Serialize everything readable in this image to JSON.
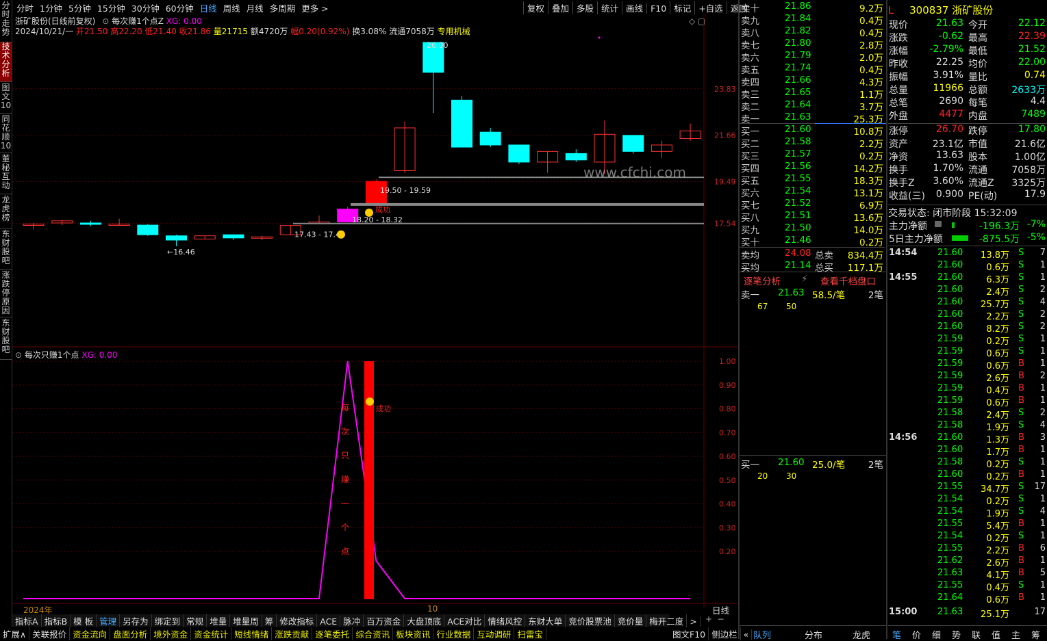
{
  "left_tabs": [
    "分时走势",
    "技术分析",
    "图文10",
    "同花顺10",
    "董秘互动",
    "龙虎榜",
    "东财股吧",
    "涨跌停原因",
    "东财股吧"
  ],
  "periods": [
    "分时",
    "1分钟",
    "5分钟",
    "15分钟",
    "30分钟",
    "60分钟",
    "日线",
    "周线",
    "月线",
    "多周期",
    "更多 >"
  ],
  "right_tools": [
    "复权",
    "叠加",
    "多股",
    "统计",
    "画线",
    "F10",
    "标记",
    "+自选",
    "返回"
  ],
  "chart": {
    "title": "浙矿股份(日线前复权)",
    "indicator_name": "每次赚1个点Z",
    "xg": "XG: 0.00",
    "info": {
      "date": "2024/10/21/一",
      "open": "开21.50",
      "high": "高22.20",
      "low": "低21.40",
      "close": "收21.86",
      "vol": "量21715",
      "amt": "额4720万",
      "chg": "幅0.20(0.92%)",
      "turn": "换3.08%",
      "float": "流通7058万",
      "sector": "专用机械"
    },
    "yticks": [
      "23.83",
      "21.66",
      "19.49",
      "17.54"
    ],
    "annotations": {
      "high": "26.00",
      "low": "←16.46",
      "r1": "19.50 - 19.59",
      "r2": "18.20 - 18.32",
      "r3": "17.43 - 17.43",
      "succ": "成功"
    },
    "watermark": "www.cfchi.com"
  },
  "sub": {
    "title": "每次只赚1个点",
    "xg": "XG: 0.00",
    "yticks": [
      "1.00",
      "0.90",
      "0.80",
      "0.70",
      "0.60",
      "0.50",
      "0.40",
      "0.30",
      "0.20"
    ],
    "vtext": [
      "每",
      "次",
      "只",
      "赚",
      "一",
      "个",
      "点"
    ],
    "succ": "成功"
  },
  "xaxis": {
    "year": "2024年",
    "mark": "10",
    "period": "日线"
  },
  "chart_data": {
    "type": "candlestick",
    "candles": [
      {
        "o": 17.45,
        "h": 17.55,
        "l": 17.25,
        "c": 17.5
      },
      {
        "o": 17.55,
        "h": 17.7,
        "l": 17.45,
        "c": 17.65
      },
      {
        "o": 17.55,
        "h": 17.65,
        "l": 17.4,
        "c": 17.5
      },
      {
        "o": 17.5,
        "h": 17.75,
        "l": 17.45,
        "c": 17.5
      },
      {
        "o": 17.45,
        "h": 17.5,
        "l": 16.95,
        "c": 17.0
      },
      {
        "o": 16.95,
        "h": 17.0,
        "l": 16.46,
        "c": 16.75
      },
      {
        "o": 16.8,
        "h": 16.95,
        "l": 16.8,
        "c": 16.95
      },
      {
        "o": 17.0,
        "h": 17.0,
        "l": 16.75,
        "c": 16.85
      },
      {
        "o": 16.85,
        "h": 16.95,
        "l": 16.75,
        "c": 16.9
      },
      {
        "o": 17.0,
        "h": 17.43,
        "l": 17.0,
        "c": 17.43
      },
      {
        "o": 17.55,
        "h": 17.9,
        "l": 17.55,
        "c": 17.6
      },
      {
        "o": 17.6,
        "h": 18.32,
        "l": 17.6,
        "c": 18.2
      },
      {
        "o": 18.4,
        "h": 19.59,
        "l": 18.3,
        "c": 19.5
      },
      {
        "o": 20.0,
        "h": 22.3,
        "l": 19.9,
        "c": 22.0
      },
      {
        "o": 26.0,
        "h": 26.0,
        "l": 22.7,
        "c": 24.6
      },
      {
        "o": 23.3,
        "h": 23.5,
        "l": 21.1,
        "c": 21.1
      },
      {
        "o": 21.8,
        "h": 22.0,
        "l": 21.1,
        "c": 21.2
      },
      {
        "o": 21.2,
        "h": 21.2,
        "l": 20.3,
        "c": 20.4
      },
      {
        "o": 20.4,
        "h": 20.9,
        "l": 19.9,
        "c": 20.9
      },
      {
        "o": 20.8,
        "h": 21.0,
        "l": 20.4,
        "c": 20.5
      },
      {
        "o": 20.4,
        "h": 22.35,
        "l": 19.85,
        "c": 21.7
      },
      {
        "o": 21.65,
        "h": 21.65,
        "l": 20.8,
        "c": 20.9
      },
      {
        "o": 20.9,
        "h": 21.4,
        "l": 20.6,
        "c": 21.2
      },
      {
        "o": 21.5,
        "h": 22.2,
        "l": 21.4,
        "c": 21.86
      }
    ],
    "sub_values": [
      0,
      0,
      0,
      0,
      0,
      0,
      0,
      0,
      0,
      0,
      0,
      1,
      0.05,
      0,
      0,
      0,
      0,
      0,
      0,
      0,
      0,
      0,
      0,
      0
    ]
  },
  "orderbook": {
    "asks": [
      [
        "卖十",
        "21.86",
        "9.2万"
      ],
      [
        "卖九",
        "21.84",
        "0.4万"
      ],
      [
        "卖八",
        "21.82",
        "0.4万"
      ],
      [
        "卖七",
        "21.80",
        "2.8万"
      ],
      [
        "卖六",
        "21.79",
        "2.0万"
      ],
      [
        "卖五",
        "21.74",
        "0.4万"
      ],
      [
        "卖四",
        "21.66",
        "4.3万"
      ],
      [
        "卖三",
        "21.65",
        "1.1万"
      ],
      [
        "卖二",
        "21.64",
        "3.7万"
      ],
      [
        "卖一",
        "21.63",
        "25.3万"
      ]
    ],
    "bids": [
      [
        "买一",
        "21.60",
        "10.8万"
      ],
      [
        "买二",
        "21.58",
        "2.2万"
      ],
      [
        "买三",
        "21.57",
        "0.2万"
      ],
      [
        "买四",
        "21.56",
        "14.2万"
      ],
      [
        "买五",
        "21.55",
        "18.3万"
      ],
      [
        "买六",
        "21.54",
        "13.1万"
      ],
      [
        "买七",
        "21.52",
        "6.9万"
      ],
      [
        "买八",
        "21.51",
        "13.6万"
      ],
      [
        "买九",
        "21.50",
        "14.0万"
      ],
      [
        "买十",
        "21.46",
        "0.2万"
      ]
    ],
    "avg_sell": [
      "卖均",
      "24.08",
      "总卖",
      "834.4万"
    ],
    "avg_buy": [
      "买均",
      "21.14",
      "总买",
      "117.1万"
    ],
    "tab1": "逐笔分析",
    "tab2": "查看千档盘口",
    "sell1": [
      "卖一",
      "21.63",
      "58.5/笔",
      "2笔"
    ],
    "sell1_q": [
      "67",
      "50"
    ],
    "buy1": [
      "买一",
      "21.60",
      "25.0/笔",
      "2笔"
    ],
    "buy1_q": [
      "20",
      "30"
    ]
  },
  "quote": {
    "flag": "L",
    "code": "300837",
    "name": "浙矿股份",
    "rows": [
      [
        "现价",
        "21.63",
        "今开",
        "22.12"
      ],
      [
        "涨跌",
        "-0.62",
        "最高",
        "22.39"
      ],
      [
        "涨幅",
        "-2.79%",
        "最低",
        "21.52"
      ],
      [
        "昨收",
        "22.25",
        "均价",
        "22.00"
      ],
      [
        "振幅",
        "3.91%",
        "量比",
        "0.74"
      ],
      [
        "总量",
        "11966",
        "总额",
        "2633万"
      ],
      [
        "总笔",
        "2690",
        "每笔",
        "4.4"
      ],
      [
        "外盘",
        "4477",
        "内盘",
        "7489"
      ]
    ],
    "rows2": [
      [
        "涨停",
        "26.70",
        "跌停",
        "17.80"
      ],
      [
        "资产",
        "23.1亿",
        "市值",
        "21.6亿"
      ],
      [
        "净资",
        "13.63",
        "股本",
        "1.00亿"
      ],
      [
        "换手",
        "1.70%",
        "流通",
        "7058万"
      ],
      [
        "换手Z",
        "3.60%",
        "流通Z",
        "3325万"
      ],
      [
        "收益(三)",
        "0.900",
        "PE(动)",
        "17.9"
      ]
    ],
    "status": "交易状态: 闭市阶段 15:32:09",
    "flow1": [
      "主力净额",
      "-196.3万",
      "-7%"
    ],
    "flow2": [
      "5日主力净额",
      "-875.5万",
      "-5%"
    ]
  },
  "trades": [
    [
      "14:54",
      "21.60",
      "13.8万",
      "S",
      "7"
    ],
    [
      "",
      "21.60",
      "0.6万",
      "S",
      "1"
    ],
    [
      "14:55",
      "21.60",
      "6.3万",
      "S",
      "1"
    ],
    [
      "",
      "21.60",
      "2.4万",
      "S",
      "2"
    ],
    [
      "",
      "21.60",
      "25.7万",
      "S",
      "4"
    ],
    [
      "",
      "21.60",
      "2.2万",
      "S",
      "2"
    ],
    [
      "",
      "21.60",
      "8.2万",
      "S",
      "2"
    ],
    [
      "",
      "21.59",
      "0.2万",
      "S",
      "1"
    ],
    [
      "",
      "21.59",
      "0.6万",
      "S",
      "1"
    ],
    [
      "",
      "21.59",
      "0.6万",
      "B",
      "1"
    ],
    [
      "",
      "21.59",
      "2.6万",
      "B",
      "2"
    ],
    [
      "",
      "21.59",
      "0.4万",
      "B",
      "1"
    ],
    [
      "",
      "21.59",
      "0.6万",
      "B",
      "1"
    ],
    [
      "",
      "21.58",
      "2.4万",
      "S",
      "2"
    ],
    [
      "",
      "21.58",
      "1.9万",
      "S",
      "4"
    ],
    [
      "14:56",
      "21.60",
      "1.3万",
      "B",
      "3"
    ],
    [
      "",
      "21.60",
      "1.7万",
      "B",
      "1"
    ],
    [
      "",
      "21.58",
      "0.2万",
      "S",
      "1"
    ],
    [
      "",
      "21.60",
      "0.2万",
      "B",
      "1"
    ],
    [
      "",
      "21.55",
      "34.7万",
      "S",
      "17"
    ],
    [
      "",
      "21.54",
      "0.2万",
      "S",
      "1"
    ],
    [
      "",
      "21.54",
      "1.9万",
      "S",
      "4"
    ],
    [
      "",
      "21.55",
      "5.4万",
      "B",
      "1"
    ],
    [
      "",
      "21.54",
      "0.2万",
      "S",
      "1"
    ],
    [
      "",
      "21.55",
      "2.2万",
      "B",
      "6"
    ],
    [
      "",
      "21.62",
      "2.6万",
      "B",
      "1"
    ],
    [
      "",
      "21.63",
      "4.1万",
      "B",
      "5"
    ],
    [
      "",
      "21.55",
      "0.4万",
      "S",
      "1"
    ],
    [
      "",
      "21.64",
      "0.6万",
      "B",
      "1"
    ],
    [
      "15:00",
      "21.63",
      "25.1万",
      "",
      "17"
    ]
  ],
  "indicator_tabs": [
    "指标A",
    "指标B",
    "模 板",
    "管理",
    "另存为",
    "绑定到",
    "常规",
    "堆量",
    "堆量周",
    "筹",
    "修改指标",
    "ACE",
    "脉冲",
    "百万资金",
    "大盘顶底",
    "ACE对比",
    "情绪风控",
    "东财大单",
    "竞价股票池",
    "竞价量",
    "梅开二度",
    ">"
  ],
  "bottom_tabs": [
    "扩展∧",
    "关联报价",
    "资金流向",
    "盘面分析",
    "境外资金",
    "资金统计",
    "短线情绪",
    "涨跌贡献",
    "逐笔委托",
    "综合资讯",
    "板块资讯",
    "行业数据",
    "互动调研",
    "扫雷宝"
  ],
  "bottom_right": [
    "图文F10",
    "侧边栏",
    "«"
  ],
  "mid_bottom": [
    "队列",
    "分布",
    "龙虎"
  ],
  "right_bottom": [
    "笔",
    "价",
    "细",
    "势",
    "联",
    "值",
    "主",
    "筹"
  ]
}
